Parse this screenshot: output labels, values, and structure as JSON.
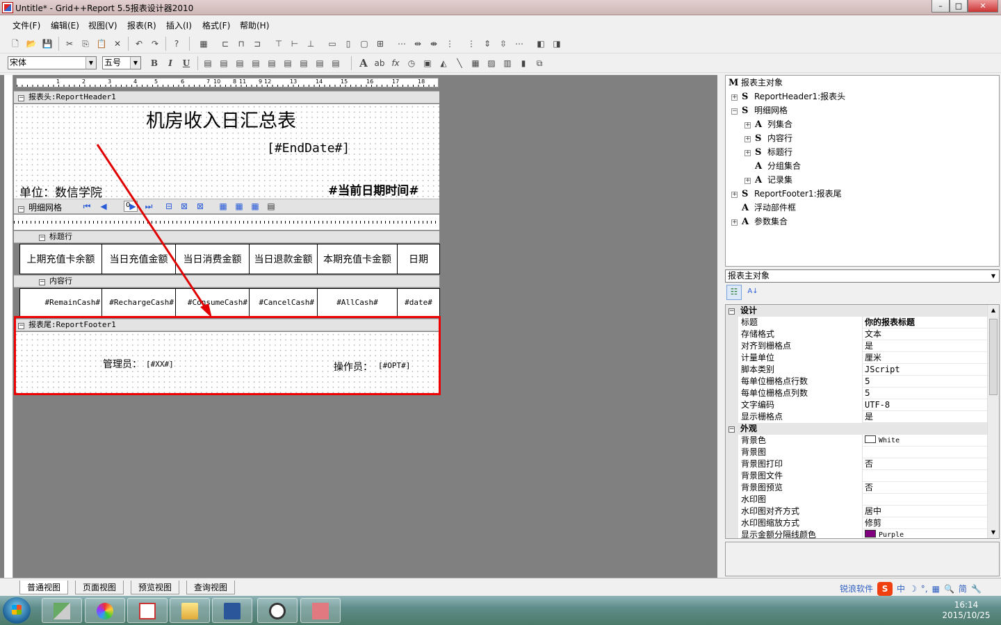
{
  "window": {
    "title": "Untitle* - Grid++Report 5.5报表设计器2010",
    "buttons": {
      "minimize": "–",
      "maximize": "□",
      "close": "✕"
    }
  },
  "menu": [
    "文件(F)",
    "编辑(E)",
    "视图(V)",
    "报表(R)",
    "插入(I)",
    "格式(F)",
    "帮助(H)"
  ],
  "toolbar2": {
    "font_name": "宋体",
    "font_size": "五号",
    "bold": "B",
    "italic": "I",
    "underline": "U"
  },
  "hruler_labels": [
    "1",
    "2",
    "3",
    "4",
    "5",
    "6",
    "7",
    "8",
    "9",
    "10",
    "11",
    "12",
    "13",
    "14",
    "15",
    "16",
    "17",
    "18"
  ],
  "report": {
    "header_band": "报表头:ReportHeader1",
    "title": "机房收入日汇总表",
    "end_date": "[#EndDate#]",
    "unit": "单位：数信学院",
    "datetime": "#当前日期时间#",
    "grid_band": "明细网格",
    "grid_page": "0",
    "title_row_band": "标题行",
    "columns": [
      "上期充值卡余额",
      "当日充值金额",
      "当日消费金额",
      "当日退款金额",
      "本期充值卡金额",
      "日期"
    ],
    "content_row_band": "内容行",
    "fields": [
      "#RemainCash#",
      "#RechargeCash#",
      "#ConsumeCash#",
      "#CancelCash#",
      "#AllCash#",
      "#date#"
    ],
    "footer_band": "报表尾:ReportFooter1",
    "manager_label": "管理员：",
    "manager_field": "[#XX#]",
    "operator_label": "操作员：",
    "operator_field": "[#OPT#]"
  },
  "tree": [
    {
      "icon": "M",
      "label": "报表主对象",
      "level": 0,
      "expander": ""
    },
    {
      "icon": "S",
      "label": "ReportHeader1:报表头",
      "level": 1,
      "expander": "+"
    },
    {
      "icon": "S",
      "label": "明细网格",
      "level": 1,
      "expander": "−"
    },
    {
      "icon": "A",
      "label": "列集合",
      "level": 2,
      "expander": "+"
    },
    {
      "icon": "S",
      "label": "内容行",
      "level": 2,
      "expander": "+"
    },
    {
      "icon": "S",
      "label": "标题行",
      "level": 2,
      "expander": "+"
    },
    {
      "icon": "A",
      "label": "分组集合",
      "level": 2,
      "expander": ""
    },
    {
      "icon": "A",
      "label": "记录集",
      "level": 2,
      "expander": "+"
    },
    {
      "icon": "S",
      "label": "ReportFooter1:报表尾",
      "level": 1,
      "expander": "+"
    },
    {
      "icon": "A",
      "label": "浮动部件框",
      "level": 1,
      "expander": ""
    },
    {
      "icon": "A",
      "label": "参数集合",
      "level": 1,
      "expander": "+"
    }
  ],
  "object_selector": "报表主对象",
  "properties": {
    "design_category": "设计",
    "design": [
      {
        "name": "标题",
        "value": "你的报表标题",
        "bold": true
      },
      {
        "name": "存储格式",
        "value": "文本"
      },
      {
        "name": "对齐到栅格点",
        "value": "是"
      },
      {
        "name": "计量单位",
        "value": "厘米"
      },
      {
        "name": "脚本类别",
        "value": "JScript"
      },
      {
        "name": "每单位栅格点行数",
        "value": "5"
      },
      {
        "name": "每单位栅格点列数",
        "value": "5"
      },
      {
        "name": "文字编码",
        "value": "UTF-8"
      },
      {
        "name": "显示栅格点",
        "value": "是"
      }
    ],
    "appearance_category": "外观",
    "appearance": [
      {
        "name": "背景色",
        "value": "White",
        "swatch": "#ffffff"
      },
      {
        "name": "背景图",
        "value": ""
      },
      {
        "name": "背景图打印",
        "value": "否"
      },
      {
        "name": "背景图文件",
        "value": ""
      },
      {
        "name": "背景图预览",
        "value": "否"
      },
      {
        "name": "水印图",
        "value": ""
      },
      {
        "name": "水印图对齐方式",
        "value": "居中"
      },
      {
        "name": "水印图缩放方式",
        "value": "修剪"
      },
      {
        "name": "显示金额分隔线颜色",
        "value": "Purple",
        "swatch": "#800080"
      }
    ]
  },
  "view_tabs": [
    "普通视图",
    "页面视图",
    "预览视图",
    "查询视图"
  ],
  "ime": {
    "brand": "锐浪软件",
    "s": "S",
    "items": [
      "中",
      "☽",
      "°,",
      "▦",
      "🔍",
      "简",
      "🔧"
    ]
  },
  "clock": {
    "time": "16:14",
    "date": "2015/10/25"
  },
  "colors": {
    "annotation_red": "#e00000",
    "accent_blue": "#2a5bd7"
  }
}
